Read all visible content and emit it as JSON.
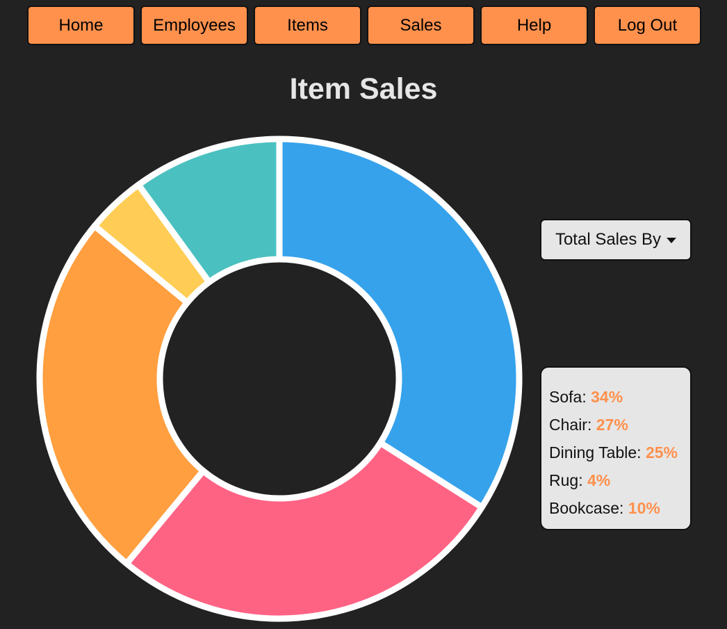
{
  "nav": {
    "items": [
      {
        "label": "Home",
        "name": "nav-home-button"
      },
      {
        "label": "Employees",
        "name": "nav-employees-button"
      },
      {
        "label": "Items",
        "name": "nav-items-button"
      },
      {
        "label": "Sales",
        "name": "nav-sales-button"
      },
      {
        "label": "Help",
        "name": "nav-help-button"
      },
      {
        "label": "Log Out",
        "name": "nav-logout-button"
      }
    ]
  },
  "page": {
    "title": "Item Sales"
  },
  "dropdown": {
    "label": "Total Sales By",
    "icon": "caret-down-icon"
  },
  "legend": {
    "items": [
      {
        "name": "Sofa",
        "value": "34%"
      },
      {
        "name": "Chair",
        "value": "27%"
      },
      {
        "name": "Dining Table",
        "value": "25%"
      },
      {
        "name": "Rug",
        "value": "4%"
      },
      {
        "name": "Bookcase",
        "value": "10%"
      }
    ]
  },
  "colors": {
    "background": "#222222",
    "nav_button": "#ff914d",
    "accent_text": "#ff914d",
    "panel": "#e6e6e6",
    "slice_border": "#ffffff"
  },
  "chart_data": {
    "type": "pie",
    "title": "Item Sales",
    "categories": [
      "Sofa",
      "Chair",
      "Dining Table",
      "Rug",
      "Bookcase"
    ],
    "values": [
      34,
      27,
      25,
      4,
      10
    ],
    "unit": "%",
    "colors": [
      "#36a2eb",
      "#ff6384",
      "#ff9f40",
      "#ffcd56",
      "#4bc0c0"
    ],
    "donut": true,
    "legend_position": "right"
  }
}
